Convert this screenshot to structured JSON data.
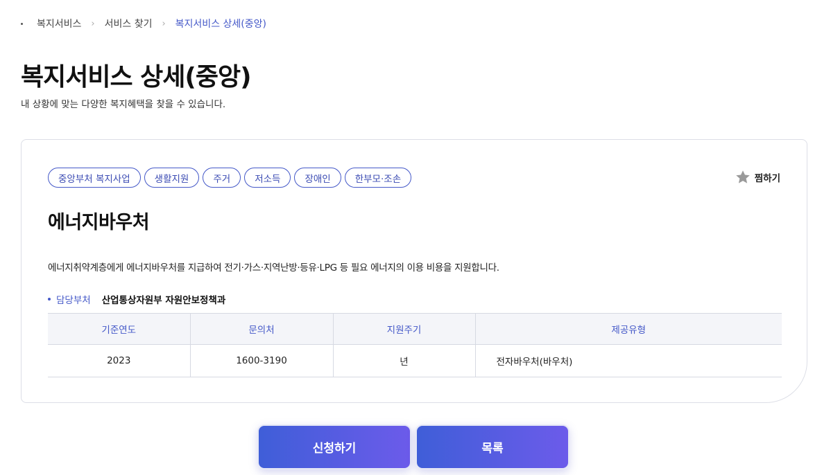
{
  "breadcrumb": {
    "items": [
      "복지서비스",
      "서비스 찾기",
      "복지서비스 상세(중앙)"
    ],
    "separator": "›"
  },
  "page": {
    "title": "복지서비스 상세(중앙)",
    "description": "내 상황에 맞는 다양한 복지혜택을 찾을 수 있습니다."
  },
  "service": {
    "tags": [
      "중앙부처 복지사업",
      "생활지원",
      "주거",
      "저소득",
      "장애인",
      "한부모·조손"
    ],
    "bookmark_label": "찜하기",
    "title": "에너지바우처",
    "description": "에너지취약계층에게 에너지바우처를 지급하여 전기·가스·지역난방·등유·LPG 등 필요 에너지의 이용 비용을 지원합니다.",
    "department_label": "담당부처",
    "department_value": "산업통상자원부 자원안보정책과",
    "table": {
      "headers": [
        "기준연도",
        "문의처",
        "지원주기",
        "제공유형"
      ],
      "row": [
        "2023",
        "1600-3190",
        "년",
        "전자바우처(바우처)"
      ]
    }
  },
  "actions": {
    "apply_label": "신청하기",
    "list_label": "목록"
  },
  "colors": {
    "accent": "#4458c8",
    "button_gradient_start": "#3f5ed8",
    "button_gradient_end": "#6c5bea"
  }
}
